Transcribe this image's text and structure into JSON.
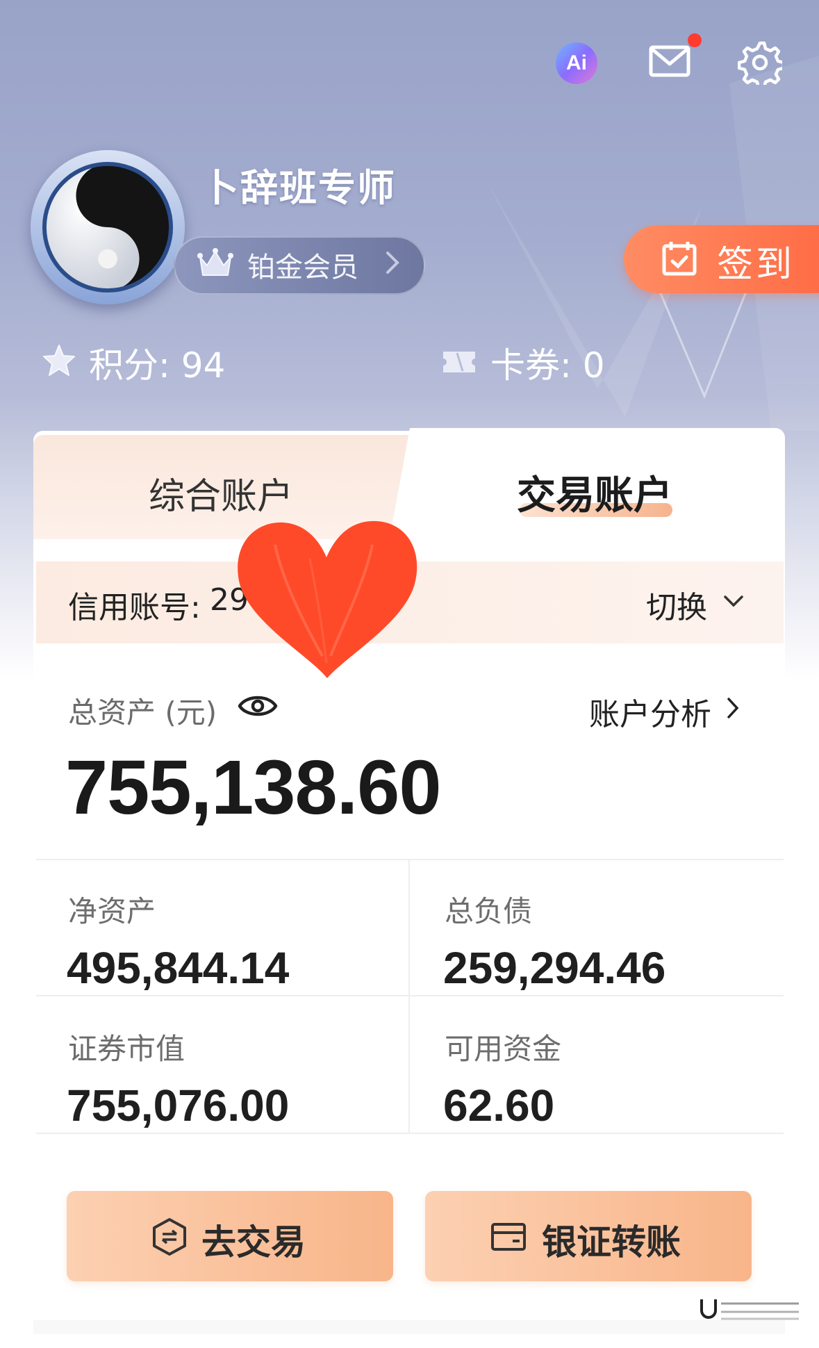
{
  "header": {
    "ai_icon_text": "Ai",
    "icons": [
      "ai-assistant-icon",
      "mail-icon",
      "settings-gear-icon"
    ],
    "mail_has_unread_dot": true
  },
  "profile": {
    "username": "卜辞班专师",
    "member_level": "铂金会员",
    "checkin_label": "签到",
    "points_label": "积分: 94",
    "coupons_label": "卡券: 0"
  },
  "tabs": [
    {
      "label": "综合账户",
      "active": false
    },
    {
      "label": "交易账户",
      "active": true
    }
  ],
  "account": {
    "credit_label": "信用账号:",
    "credit_number_visible": "29",
    "switch_label": "切换"
  },
  "summary": {
    "total_label": "总资产 (元)",
    "analysis_label": "账户分析",
    "total_value": "755,138.60"
  },
  "stats": [
    {
      "label": "净资产",
      "value": "495,844.14"
    },
    {
      "label": "总负债",
      "value": "259,294.46"
    },
    {
      "label": "证券市值",
      "value": "755,076.00"
    },
    {
      "label": "可用资金",
      "value": "62.60"
    }
  ],
  "actions": {
    "trade_label": "去交易",
    "transfer_label": "银证转账"
  },
  "colors": {
    "hero_bg": "#a4adcf",
    "accent_orange": "#ff6b44",
    "button_peach": "#f8b589",
    "heart_red": "#ff4a2a",
    "unread_dot": "#ff3b30"
  }
}
